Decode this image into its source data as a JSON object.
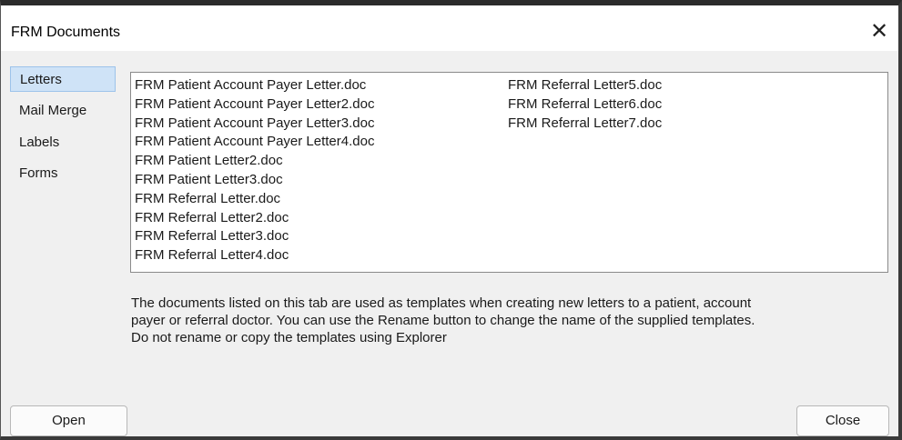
{
  "window": {
    "title": "FRM Documents",
    "close_glyph": "✕"
  },
  "nav": {
    "items": [
      {
        "label": "Letters",
        "selected": true
      },
      {
        "label": "Mail Merge",
        "selected": false
      },
      {
        "label": "Labels",
        "selected": false
      },
      {
        "label": "Forms",
        "selected": false
      }
    ]
  },
  "files": {
    "column1": [
      "FRM Patient Account Payer Letter.doc",
      "FRM Patient Account Payer Letter2.doc",
      "FRM Patient Account Payer Letter3.doc",
      "FRM Patient Account Payer Letter4.doc",
      "FRM Patient Letter2.doc",
      "FRM Patient Letter3.doc",
      "FRM Referral Letter.doc",
      "FRM Referral Letter2.doc",
      "FRM Referral Letter3.doc",
      "FRM Referral Letter4.doc"
    ],
    "column2": [
      "FRM Referral Letter5.doc",
      "FRM Referral Letter6.doc",
      "FRM Referral Letter7.doc"
    ]
  },
  "info": {
    "line1": "The documents listed on this tab are used as templates when creating new letters to a patient, account",
    "line2": "payer or referral doctor. You can use the Rename button to change the name of the supplied templates.",
    "line3": "Do not rename or copy the templates using Explorer"
  },
  "buttons": {
    "open_label": "Open",
    "close_label": "Close"
  }
}
